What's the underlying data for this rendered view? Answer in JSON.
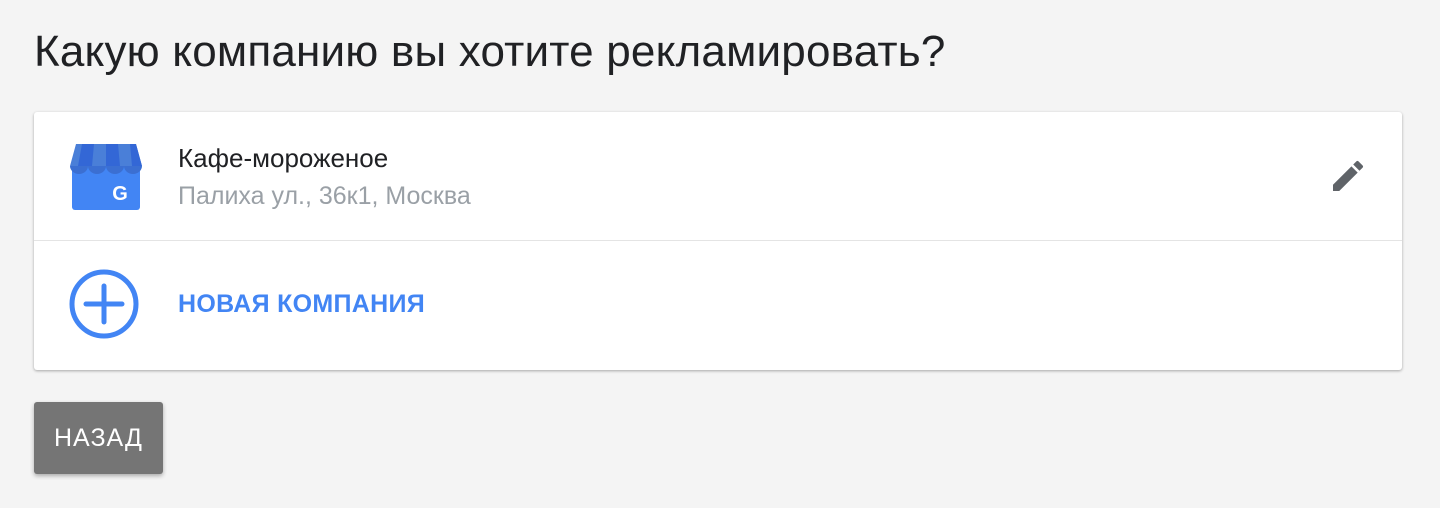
{
  "page": {
    "title": "Какую компанию вы хотите рекламировать?"
  },
  "business": {
    "name": "Кафе-мороженое",
    "address": "Палиха ул., 36к1, Москва",
    "icon": "google-my-business-store-icon",
    "edit_icon": "pencil-icon"
  },
  "new_business": {
    "label": "НОВАЯ КОМПАНИЯ",
    "icon": "plus-circle-icon"
  },
  "actions": {
    "back_label": "НАЗАД"
  },
  "colors": {
    "accent": "#4285f4",
    "background": "#f4f4f4",
    "back_button": "#757575",
    "secondary_text": "#9aa0a6"
  }
}
